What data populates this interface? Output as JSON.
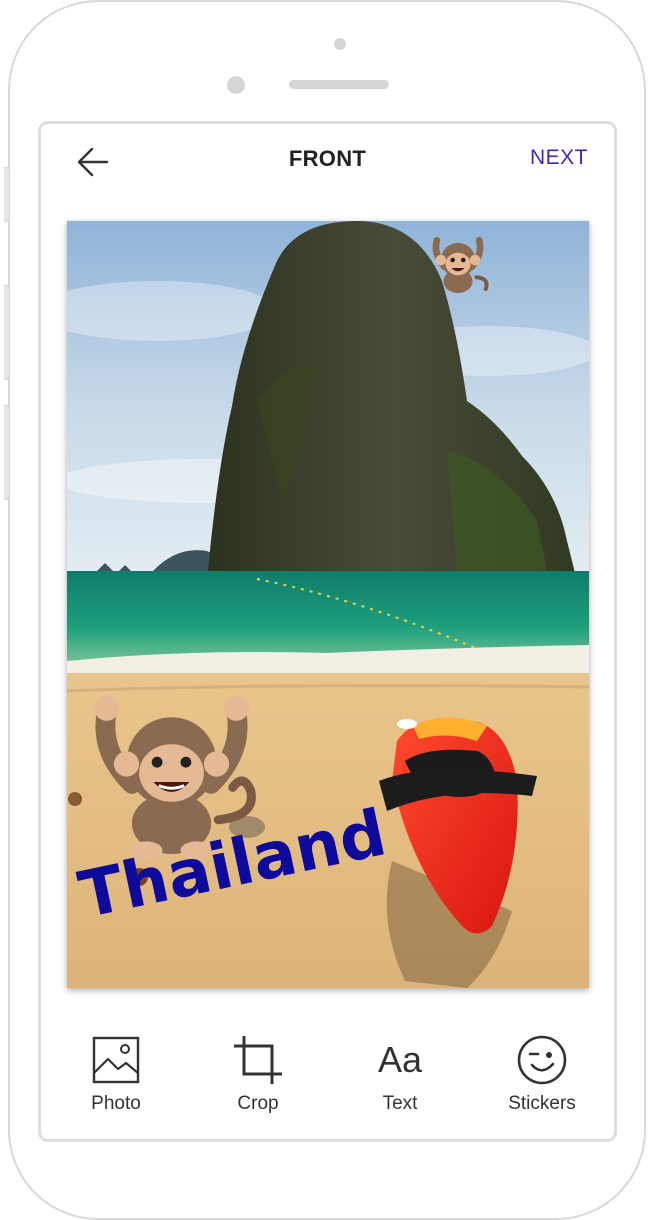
{
  "header": {
    "title": "FRONT",
    "next_label": "NEXT"
  },
  "card": {
    "sticker_text": "Thailand"
  },
  "toolbar": {
    "items": [
      {
        "label": "Photo",
        "icon": "image-icon"
      },
      {
        "label": "Crop",
        "icon": "crop-icon"
      },
      {
        "label": "Text",
        "icon": "text-icon",
        "glyph": "Aa"
      },
      {
        "label": "Stickers",
        "icon": "wink-face-icon"
      }
    ]
  },
  "colors": {
    "accent": "#3b2cb8",
    "sticker_text": "#0d0a9c"
  }
}
